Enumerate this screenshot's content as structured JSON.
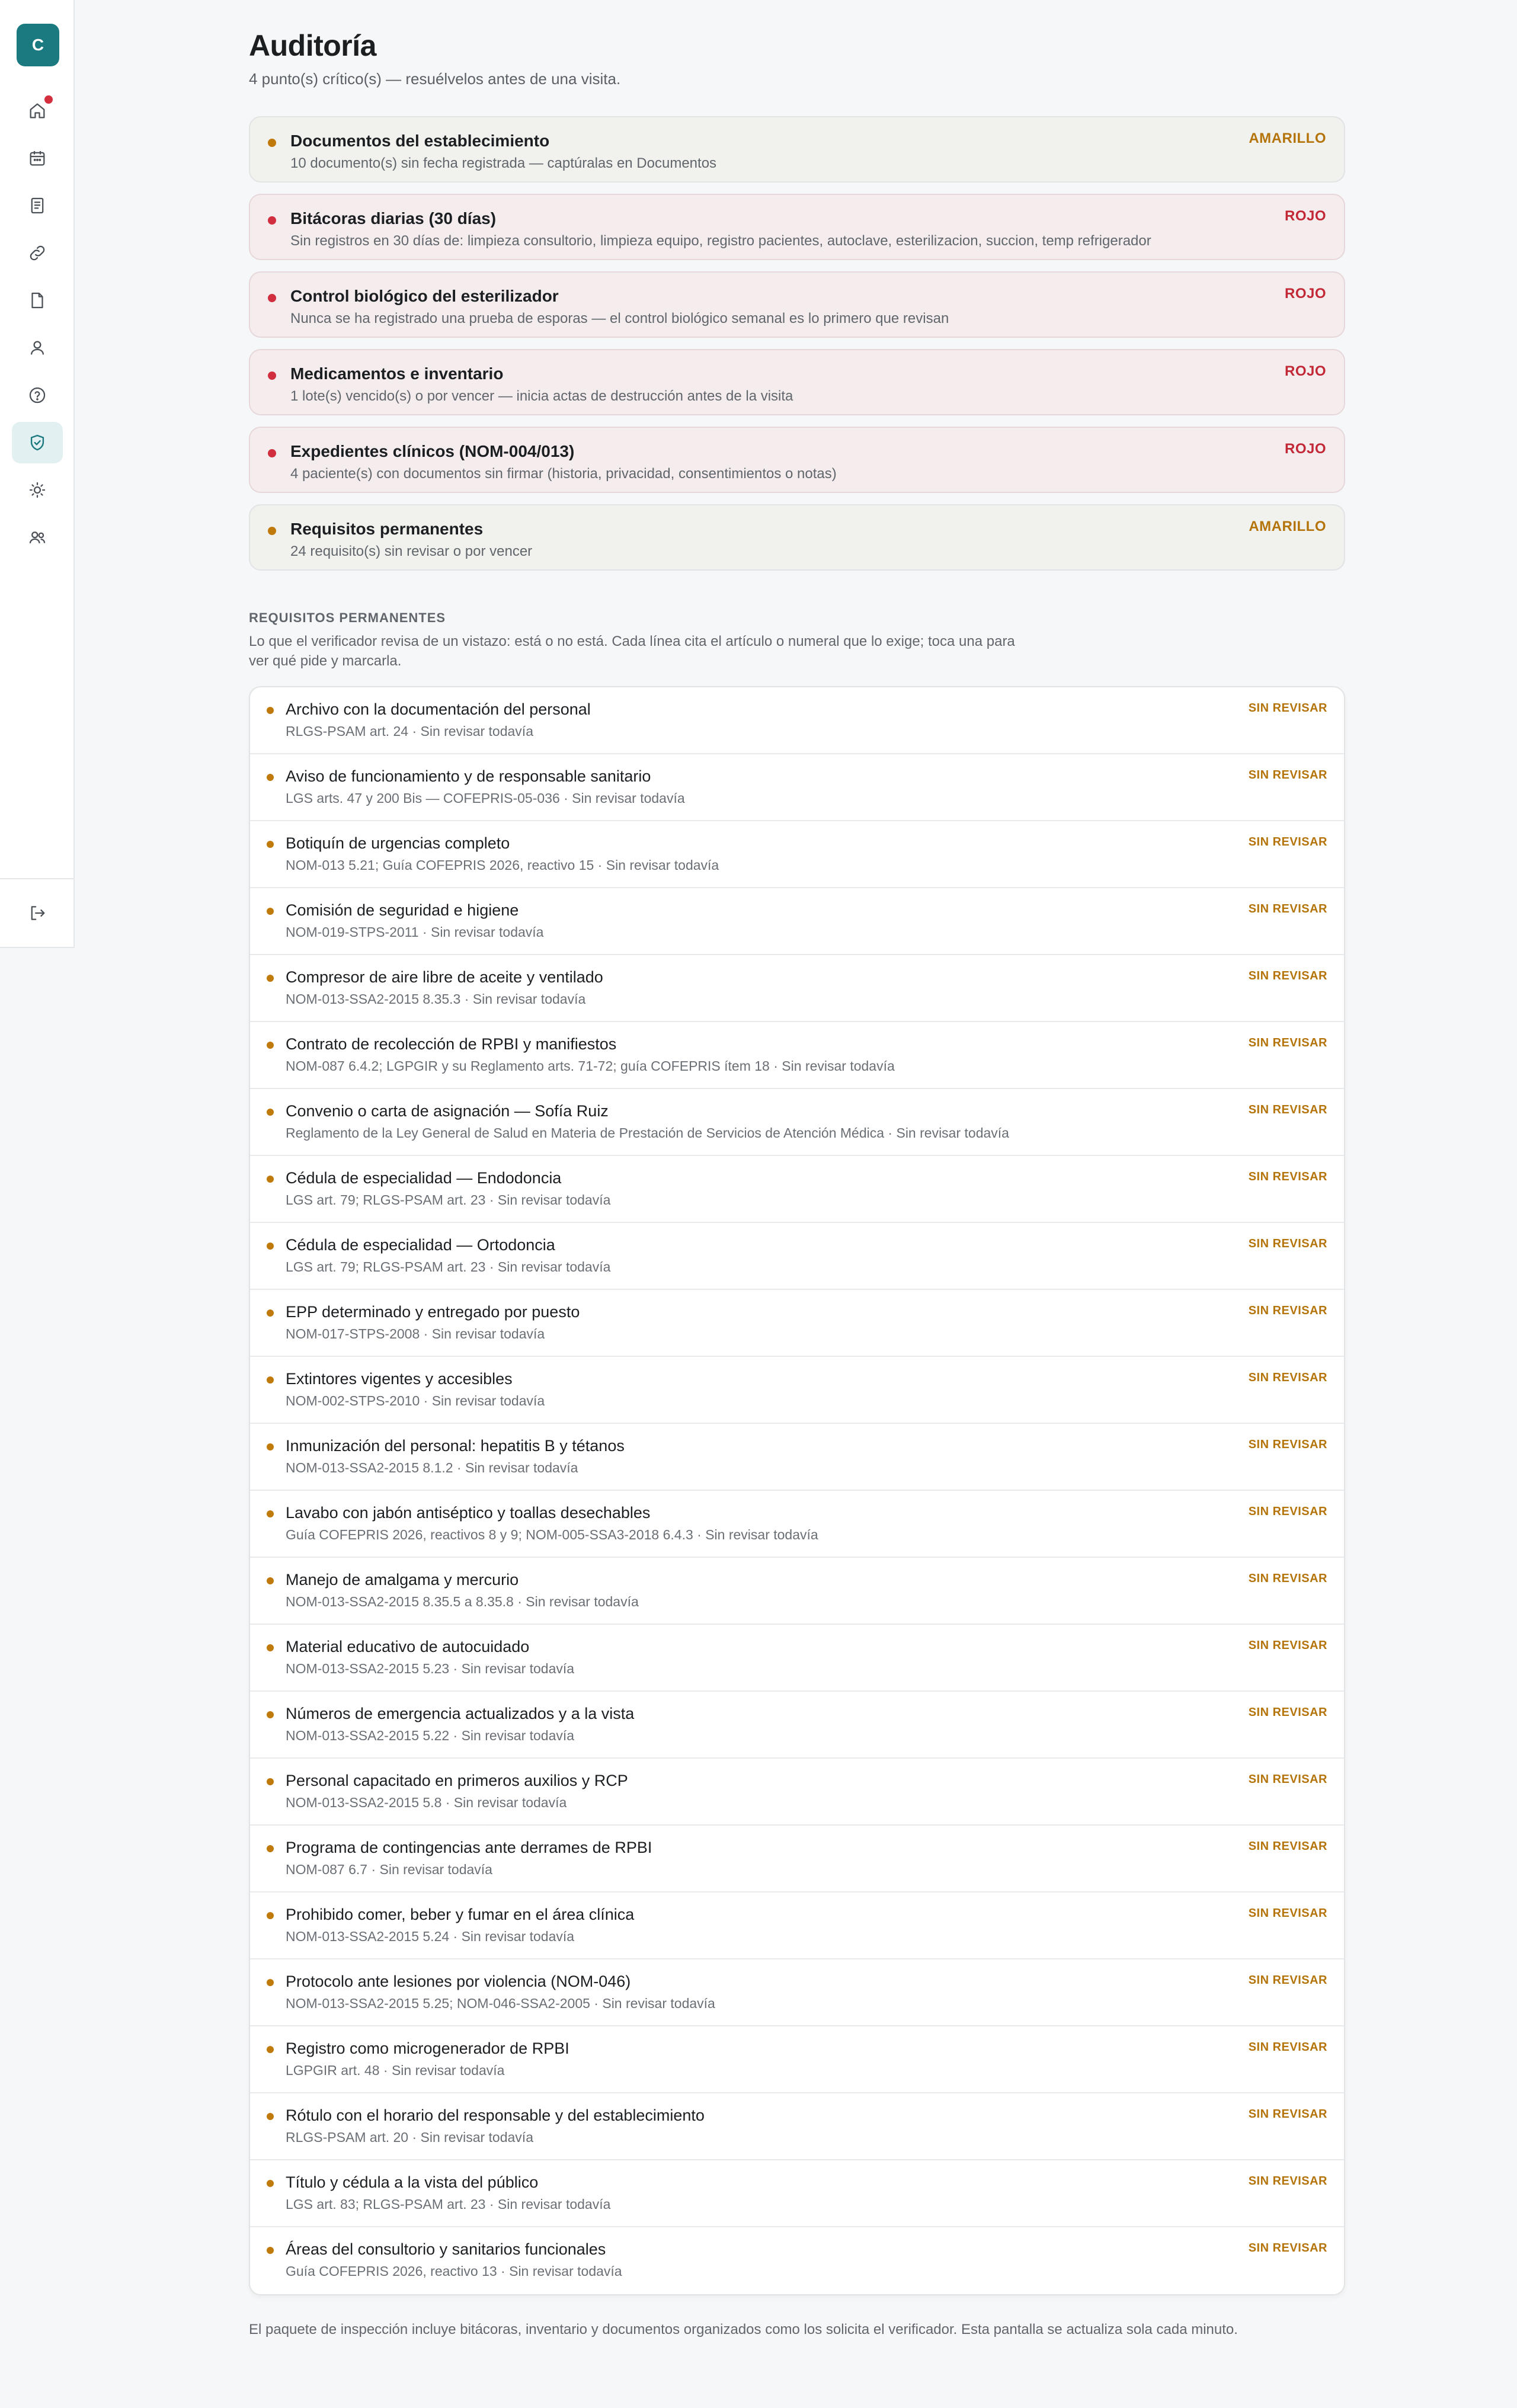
{
  "sidebar": {
    "brand_letter": "C",
    "items": [
      {
        "icon": "home-icon",
        "name": "sidebar-item-inicio",
        "notification": true
      },
      {
        "icon": "calendar-icon",
        "name": "sidebar-item-agenda"
      },
      {
        "icon": "document-list-icon",
        "name": "sidebar-item-registros"
      },
      {
        "icon": "link-icon",
        "name": "sidebar-item-enlaces"
      },
      {
        "icon": "file-icon",
        "name": "sidebar-item-documentos"
      },
      {
        "icon": "user-icon",
        "name": "sidebar-item-pacientes"
      },
      {
        "icon": "help-icon",
        "name": "sidebar-item-ayuda"
      },
      {
        "icon": "shield-check-icon",
        "name": "sidebar-item-auditoria",
        "active": true
      },
      {
        "icon": "sun-icon",
        "name": "sidebar-item-ajustes"
      },
      {
        "icon": "users-icon",
        "name": "sidebar-item-equipo"
      }
    ],
    "logout_icon": "logout-icon"
  },
  "header": {
    "title": "Auditoría",
    "subtitle": "4 punto(s) crítico(s) — resuélvelos antes de una visita."
  },
  "audit_items": [
    {
      "title": "Documentos del establecimiento",
      "description": "10 documento(s) sin fecha registrada — captúralas en Documentos",
      "status": "AMARILLO",
      "level": "amarillo"
    },
    {
      "title": "Bitácoras diarias (30 días)",
      "description": "Sin registros en 30 días de: limpieza consultorio, limpieza equipo, registro pacientes, autoclave, esterilizacion, succion, temp refrigerador",
      "status": "ROJO",
      "level": "rojo"
    },
    {
      "title": "Control biológico del esterilizador",
      "description": "Nunca se ha registrado una prueba de esporas — el control biológico semanal es lo primero que revisan",
      "status": "ROJO",
      "level": "rojo"
    },
    {
      "title": "Medicamentos e inventario",
      "description": "1 lote(s) vencido(s) o por vencer — inicia actas de destrucción antes de la visita",
      "status": "ROJO",
      "level": "rojo"
    },
    {
      "title": "Expedientes clínicos (NOM-004/013)",
      "description": "4 paciente(s) con documentos sin firmar (historia, privacidad, consentimientos o notas)",
      "status": "ROJO",
      "level": "rojo"
    },
    {
      "title": "Requisitos permanentes",
      "description": "24 requisito(s) sin revisar o por vencer",
      "status": "AMARILLO",
      "level": "amarillo"
    }
  ],
  "requirements_section": {
    "heading": "REQUISITOS PERMANENTES",
    "description": "Lo que el verificador revisa de un vistazo: está o no está. Cada línea cita el artículo o numeral que lo exige; toca una para ver qué pide y marcarla.",
    "items": [
      {
        "title": "Archivo con la documentación del personal",
        "meta": "RLGS-PSAM art. 24 · Sin revisar todavía",
        "status": "SIN REVISAR"
      },
      {
        "title": "Aviso de funcionamiento y de responsable sanitario",
        "meta": "LGS arts. 47 y 200 Bis — COFEPRIS-05-036 · Sin revisar todavía",
        "status": "SIN REVISAR"
      },
      {
        "title": "Botiquín de urgencias completo",
        "meta": "NOM-013 5.21; Guía COFEPRIS 2026, reactivo 15 · Sin revisar todavía",
        "status": "SIN REVISAR"
      },
      {
        "title": "Comisión de seguridad e higiene",
        "meta": "NOM-019-STPS-2011 · Sin revisar todavía",
        "status": "SIN REVISAR"
      },
      {
        "title": "Compresor de aire libre de aceite y ventilado",
        "meta": "NOM-013-SSA2-2015 8.35.3 · Sin revisar todavía",
        "status": "SIN REVISAR"
      },
      {
        "title": "Contrato de recolección de RPBI y manifiestos",
        "meta": "NOM-087 6.4.2; LGPGIR y su Reglamento arts. 71-72; guía COFEPRIS ítem 18 · Sin revisar todavía",
        "status": "SIN REVISAR"
      },
      {
        "title": "Convenio o carta de asignación — Sofía Ruiz",
        "meta": "Reglamento de la Ley General de Salud en Materia de Prestación de Servicios de Atención Médica · Sin revisar todavía",
        "status": "SIN REVISAR"
      },
      {
        "title": "Cédula de especialidad — Endodoncia",
        "meta": "LGS art. 79; RLGS-PSAM art. 23 · Sin revisar todavía",
        "status": "SIN REVISAR"
      },
      {
        "title": "Cédula de especialidad — Ortodoncia",
        "meta": "LGS art. 79; RLGS-PSAM art. 23 · Sin revisar todavía",
        "status": "SIN REVISAR"
      },
      {
        "title": "EPP determinado y entregado por puesto",
        "meta": "NOM-017-STPS-2008 · Sin revisar todavía",
        "status": "SIN REVISAR"
      },
      {
        "title": "Extintores vigentes y accesibles",
        "meta": "NOM-002-STPS-2010 · Sin revisar todavía",
        "status": "SIN REVISAR"
      },
      {
        "title": "Inmunización del personal: hepatitis B y tétanos",
        "meta": "NOM-013-SSA2-2015 8.1.2 · Sin revisar todavía",
        "status": "SIN REVISAR"
      },
      {
        "title": "Lavabo con jabón antiséptico y toallas desechables",
        "meta": "Guía COFEPRIS 2026, reactivos 8 y 9; NOM-005-SSA3-2018 6.4.3 · Sin revisar todavía",
        "status": "SIN REVISAR"
      },
      {
        "title": "Manejo de amalgama y mercurio",
        "meta": "NOM-013-SSA2-2015 8.35.5 a 8.35.8 · Sin revisar todavía",
        "status": "SIN REVISAR"
      },
      {
        "title": "Material educativo de autocuidado",
        "meta": "NOM-013-SSA2-2015 5.23 · Sin revisar todavía",
        "status": "SIN REVISAR"
      },
      {
        "title": "Números de emergencia actualizados y a la vista",
        "meta": "NOM-013-SSA2-2015 5.22 · Sin revisar todavía",
        "status": "SIN REVISAR"
      },
      {
        "title": "Personal capacitado en primeros auxilios y RCP",
        "meta": "NOM-013-SSA2-2015 5.8 · Sin revisar todavía",
        "status": "SIN REVISAR"
      },
      {
        "title": "Programa de contingencias ante derrames de RPBI",
        "meta": "NOM-087 6.7 · Sin revisar todavía",
        "status": "SIN REVISAR"
      },
      {
        "title": "Prohibido comer, beber y fumar en el área clínica",
        "meta": "NOM-013-SSA2-2015 5.24 · Sin revisar todavía",
        "status": "SIN REVISAR"
      },
      {
        "title": "Protocolo ante lesiones por violencia (NOM-046)",
        "meta": "NOM-013-SSA2-2015 5.25; NOM-046-SSA2-2005 · Sin revisar todavía",
        "status": "SIN REVISAR"
      },
      {
        "title": "Registro como microgenerador de RPBI",
        "meta": "LGPGIR art. 48 · Sin revisar todavía",
        "status": "SIN REVISAR"
      },
      {
        "title": "Rótulo con el horario del responsable y del establecimiento",
        "meta": "RLGS-PSAM art. 20 · Sin revisar todavía",
        "status": "SIN REVISAR"
      },
      {
        "title": "Título y cédula a la vista del público",
        "meta": "LGS art. 83; RLGS-PSAM art. 23 · Sin revisar todavía",
        "status": "SIN REVISAR"
      },
      {
        "title": "Áreas del consultorio y sanitarios funcionales",
        "meta": "Guía COFEPRIS 2026, reactivo 13 · Sin revisar todavía",
        "status": "SIN REVISAR"
      }
    ]
  },
  "footer": {
    "note": "El paquete de inspección incluye bitácoras, inventario y documentos organizados como los solicita el verificador. Esta pantalla se actualiza sola cada minuto."
  },
  "colors": {
    "brand": "#1b7a80",
    "amarillo": "#b5740a",
    "rojo": "#c32837",
    "active_nav_bg": "#e3f0f1"
  }
}
